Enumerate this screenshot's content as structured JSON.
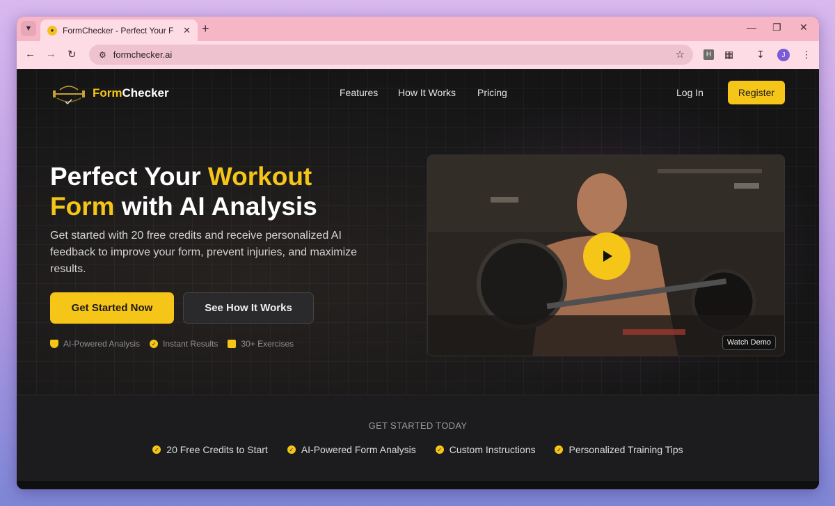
{
  "browser": {
    "tab_title": "FormChecker - Perfect Your Form",
    "url": "formchecker.ai",
    "profile_initial": "J",
    "ext_label": "H"
  },
  "nav": {
    "brand_prefix": "Form",
    "brand_suffix": "Checker",
    "links": [
      "Features",
      "How It Works",
      "Pricing"
    ],
    "login": "Log In",
    "register": "Register"
  },
  "hero": {
    "title_part1": "Perfect Your ",
    "title_accent1": "Workout",
    "title_accent2": "Form",
    "title_part2": " with AI Analysis",
    "subtitle": "Get started with 20 free credits and receive personalized AI feedback to improve your form, prevent injuries, and maximize results.",
    "cta_primary": "Get Started Now",
    "cta_secondary": "See How It Works",
    "features": [
      "AI-Powered Analysis",
      "Instant Results",
      "30+ Exercises"
    ],
    "video_label": "Watch Demo"
  },
  "get_started": {
    "title": "GET STARTED TODAY",
    "items": [
      "20 Free Credits to Start",
      "AI-Powered Form Analysis",
      "Custom Instructions",
      "Personalized Training Tips"
    ]
  },
  "colors": {
    "accent": "#f5c518",
    "page_bg": "#151516"
  }
}
